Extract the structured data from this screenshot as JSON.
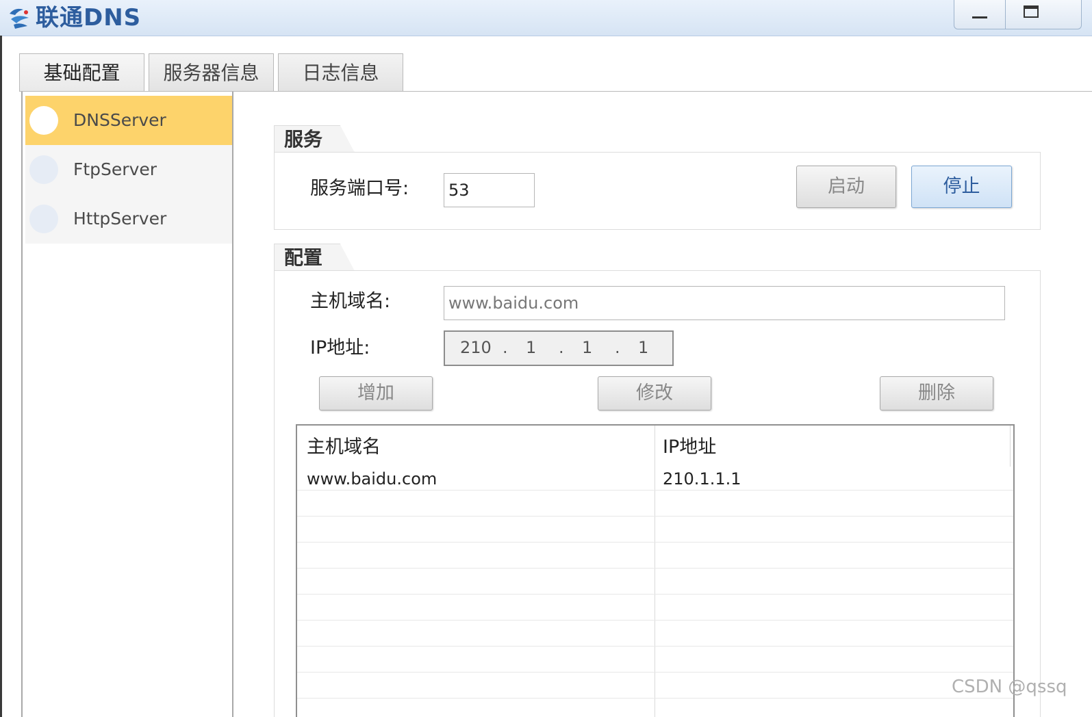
{
  "window": {
    "title": "联通DNS"
  },
  "tabs": [
    {
      "label": "基础配置"
    },
    {
      "label": "服务器信息"
    },
    {
      "label": "日志信息"
    }
  ],
  "sidebar": {
    "items": [
      {
        "label": "DNSServer",
        "selected": true
      },
      {
        "label": "FtpServer",
        "selected": false
      },
      {
        "label": "HttpServer",
        "selected": false
      }
    ]
  },
  "service": {
    "group_title": "服务",
    "port_label": "服务端口号:",
    "port_value": "53",
    "start_label": "启动",
    "stop_label": "停止"
  },
  "config": {
    "group_title": "配置",
    "domain_label": "主机域名:",
    "domain_value": "www.baidu.com",
    "ip_label": "IP地址:",
    "ip_segments": [
      "210",
      "1",
      "1",
      "1"
    ],
    "add_label": "增加",
    "modify_label": "修改",
    "delete_label": "删除"
  },
  "table": {
    "columns": [
      "主机域名",
      "IP地址"
    ],
    "rows": [
      [
        "www.baidu.com",
        "210.1.1.1"
      ]
    ]
  },
  "watermark": "CSDN @qssq",
  "colors": {
    "selected_item": "#fdd36b",
    "title_text": "#2d5d9e"
  }
}
